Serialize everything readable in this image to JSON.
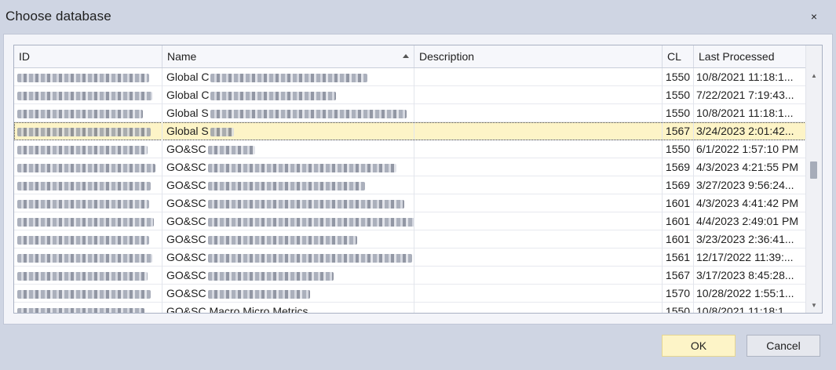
{
  "window": {
    "title": "Choose database",
    "close_icon": "×"
  },
  "grid": {
    "columns": [
      "ID",
      "Name",
      "Description",
      "CL",
      "Last Processed"
    ],
    "sorted_column": "Name",
    "rows": [
      {
        "id": "",
        "name": "Global C",
        "description": "",
        "cl": "1550",
        "last_processed": "10/8/2021 11:18:1...",
        "selected": false
      },
      {
        "id": "",
        "name": "Global C",
        "description": "",
        "cl": "1550",
        "last_processed": "7/22/2021 7:19:43...",
        "selected": false
      },
      {
        "id": "",
        "name": "Global S",
        "description": "",
        "cl": "1550",
        "last_processed": "10/8/2021 11:18:1...",
        "selected": false
      },
      {
        "id": "",
        "name": "Global S",
        "description": "",
        "cl": "1567",
        "last_processed": "3/24/2023 2:01:42...",
        "selected": true
      },
      {
        "id": "",
        "name": "GO&SC",
        "description": "",
        "cl": "1550",
        "last_processed": "6/1/2022 1:57:10 PM",
        "selected": false
      },
      {
        "id": "",
        "name": "GO&SC",
        "description": "",
        "cl": "1569",
        "last_processed": "4/3/2023 4:21:55 PM",
        "selected": false
      },
      {
        "id": "",
        "name": "GO&SC",
        "description": "",
        "cl": "1569",
        "last_processed": "3/27/2023 9:56:24...",
        "selected": false
      },
      {
        "id": "",
        "name": "GO&SC",
        "description": "",
        "cl": "1601",
        "last_processed": "4/3/2023 4:41:42 PM",
        "selected": false
      },
      {
        "id": "",
        "name": "GO&SC",
        "description": "",
        "cl": "1601",
        "last_processed": "4/4/2023 2:49:01 PM",
        "selected": false
      },
      {
        "id": "",
        "name": "GO&SC",
        "description": "",
        "cl": "1601",
        "last_processed": "3/23/2023 2:36:41...",
        "selected": false
      },
      {
        "id": "",
        "name": "GO&SC",
        "description": "",
        "cl": "1561",
        "last_processed": "12/17/2022 11:39:...",
        "selected": false
      },
      {
        "id": "",
        "name": "GO&SC",
        "description": "",
        "cl": "1567",
        "last_processed": "3/17/2023 8:45:28...",
        "selected": false
      },
      {
        "id": "",
        "name": "GO&SC",
        "description": "",
        "cl": "1570",
        "last_processed": "10/28/2022 1:55:1...",
        "selected": false
      },
      {
        "id": "",
        "name": "GO&SC Macro Micro Metrics",
        "description": "",
        "cl": "1550",
        "last_processed": "10/8/2021 11:18:1...",
        "selected": false
      }
    ]
  },
  "buttons": {
    "ok": "OK",
    "cancel": "Cancel"
  },
  "colors": {
    "selected_row": "#fdf4c7",
    "window_bg": "#cfd5e3",
    "ok_bg": "#fdf4c7"
  }
}
